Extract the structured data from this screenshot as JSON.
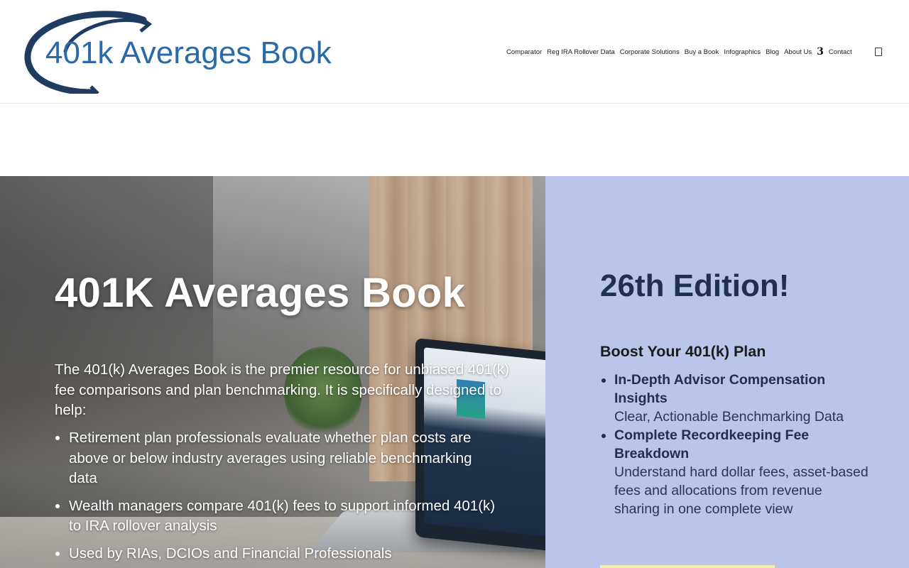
{
  "header": {
    "logo_text": "401k Averages Book",
    "nav": [
      "Comparator",
      "Reg IRA Rollover Data",
      "Corporate Solutions",
      "Buy a Book",
      "Infographics",
      "Blog",
      "About Us",
      "3",
      "Contact"
    ]
  },
  "hero": {
    "title": "401K Averages Book",
    "intro": "The 401(k) Averages Book is the premier resource for unbiased 401(k) fee comparisons and plan benchmarking. It is specifically designed to help:",
    "bullets": [
      "Retirement plan professionals evaluate whether plan costs are above or below industry averages using reliable benchmarking data",
      "Wealth managers compare 401(k) fees to support informed 401(k) to IRA rollover analysis",
      "Used by RIAs, DCIOs and Financial Professionals"
    ]
  },
  "sidebar": {
    "edition": "26th Edition!",
    "heading": "Boost Your 401(k) Plan",
    "features": [
      {
        "title": "In-Depth Advisor Compensation Insights",
        "desc": "Clear, Actionable Benchmarking Data"
      },
      {
        "title": "Complete Recordkeeping Fee Breakdown",
        "desc": "Understand hard dollar fees, asset-based fees and allocations from revenue sharing in one complete view"
      }
    ]
  },
  "colors": {
    "brand_navy": "#1f3b5f",
    "brand_blue": "#2a6aa8",
    "panel_bg": "#bac6e9",
    "panel_text": "#22304f"
  }
}
